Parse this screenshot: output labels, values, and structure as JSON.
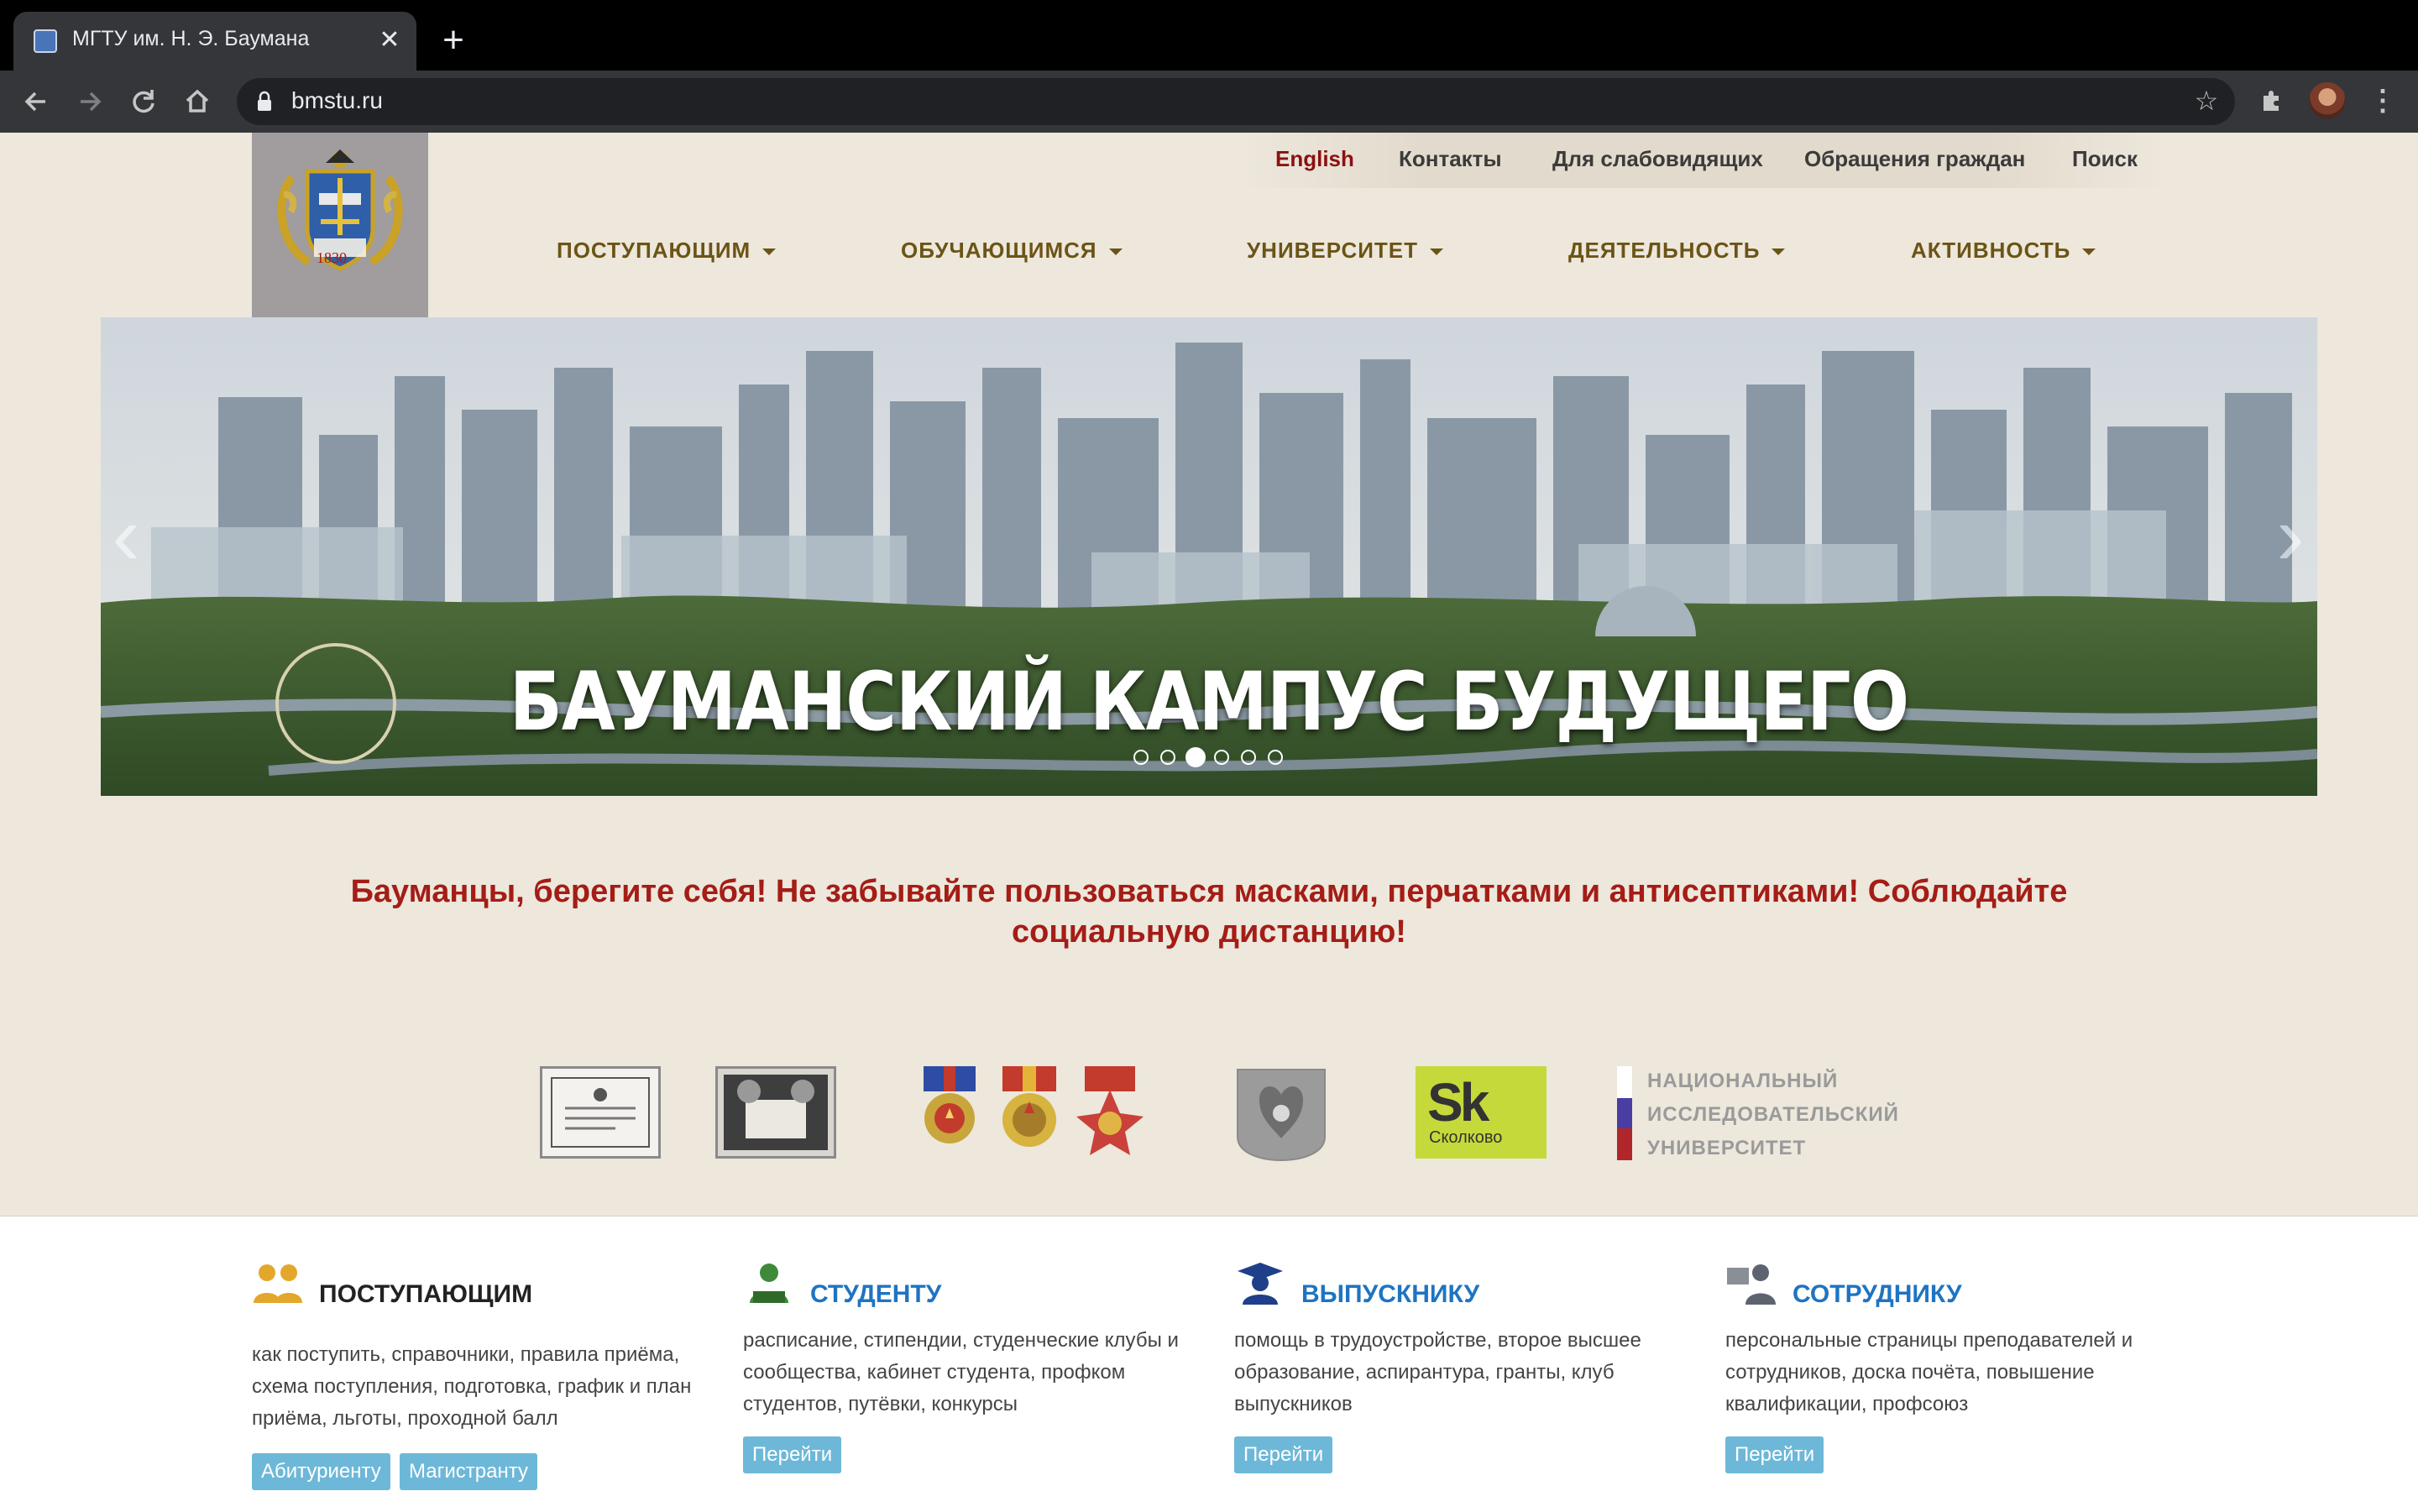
{
  "browser": {
    "tab_title": "МГТУ им. Н. Э. Баумана",
    "tab_close": "✕",
    "new_tab": "+",
    "url": "bmstu.ru",
    "icons": [
      "back-arrow-icon",
      "forward-arrow-icon",
      "reload-icon",
      "home-icon",
      "lock-icon",
      "star-icon",
      "extensions-icon",
      "menu-icon"
    ]
  },
  "header": {
    "crest_year": "1830",
    "top_links": [
      "English",
      "Контакты",
      "Для слабовидящих",
      "Обращения граждан",
      "Поиск"
    ],
    "nav": [
      "ПОСТУПАЮЩИМ",
      "ОБУЧАЮЩИМСЯ",
      "УНИВЕРСИТЕТ",
      "ДЕЯТЕЛЬНОСТЬ",
      "АКТИВНОСТЬ"
    ]
  },
  "banner": {
    "title": "БАУМАНСКИЙ КАМПУС БУДУЩЕГО",
    "slides": 6,
    "active_slide": 3,
    "prev": "‹",
    "next": "›"
  },
  "notice": "Бауманцы, берегите себя! Не забывайте пользоваться масками, перчатками и антисептиками! Соблюдайте социальную дистанцию!",
  "partners": {
    "skolkovo_big": "Sk",
    "skolkovo_small": "Сколково",
    "niu_lines": [
      "НАЦИОНАЛЬНЫЙ",
      "ИССЛЕДОВАТЕЛЬСКИЙ",
      "УНИВЕРСИТЕТ"
    ]
  },
  "cards": [
    {
      "title": "ПОСТУПАЮЩИМ",
      "color": "#222222",
      "desc": "как поступить, справочники, правила приёма, схема поступления, подготовка, график и план приёма, льготы, проходной балл",
      "buttons": [
        "Абитуриенту",
        "Магистранту"
      ]
    },
    {
      "title": "СТУДЕНТУ",
      "color": "#1e74c2",
      "desc": "расписание, стипендии, студенческие клубы и сообщества, кабинет студента, профком студентов, путёвки, конкурсы",
      "buttons": [
        "Перейти"
      ]
    },
    {
      "title": "ВЫПУСКНИКУ",
      "color": "#1e74c2",
      "desc": "помощь в трудоустройстве, второе высшее образование, аспирантура, гранты, клуб выпускников",
      "buttons": [
        "Перейти"
      ]
    },
    {
      "title": "СОТРУДНИКУ",
      "color": "#1e74c2",
      "desc": "персональные страницы преподавателей и сотрудников, доска почёта, повышение квалификации, профсоюз",
      "buttons": [
        "Перейти"
      ]
    }
  ]
}
